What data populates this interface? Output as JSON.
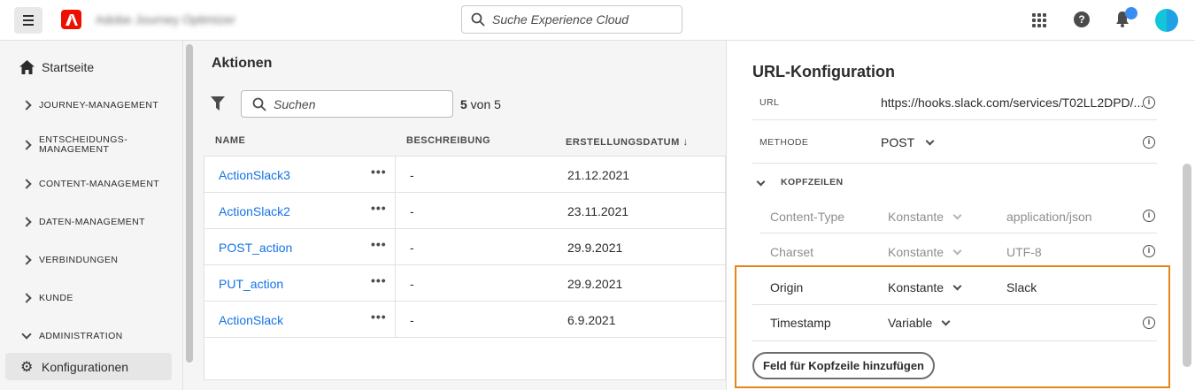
{
  "topbar": {
    "app_name": "Adobe Journey Optimizer",
    "search_placeholder": "Suche Experience Cloud"
  },
  "sidebar": {
    "home_label": "Startseite",
    "items": [
      {
        "label": "JOURNEY-MANAGEMENT"
      },
      {
        "label": "ENTSCHEIDUNGS-\nMANAGEMENT"
      },
      {
        "label": "CONTENT-MANAGEMENT"
      },
      {
        "label": "DATEN-MANAGEMENT"
      },
      {
        "label": "VERBINDUNGEN"
      },
      {
        "label": "KUNDE"
      },
      {
        "label": "ADMINISTRATION"
      }
    ],
    "active_label": "Konfigurationen"
  },
  "main": {
    "title": "Aktionen",
    "search_placeholder": "Suchen",
    "count_bold": "5",
    "count_rest": " von 5",
    "columns": [
      "NAME",
      "BESCHREIBUNG",
      "ERSTELLUNGSDATUM"
    ],
    "rows": [
      {
        "name": "ActionSlack3",
        "desc": "-",
        "date": "21.12.2021"
      },
      {
        "name": "ActionSlack2",
        "desc": "-",
        "date": "23.11.2021"
      },
      {
        "name": "POST_action",
        "desc": "-",
        "date": "29.9.2021"
      },
      {
        "name": "PUT_action",
        "desc": "-",
        "date": "29.9.2021"
      },
      {
        "name": "ActionSlack",
        "desc": "-",
        "date": "6.9.2021"
      }
    ],
    "more_glyph": "•••"
  },
  "panel": {
    "title": "URL-Konfiguration",
    "url_label": "URL",
    "url_value": "https://hooks.slack.com/services/T02LL2DPD/...",
    "method_label": "METHODE",
    "method_value": "POST",
    "headers_label": "KOPFZEILEN",
    "headers": [
      {
        "name": "Content-Type",
        "type": "Konstante",
        "value": "application/json"
      },
      {
        "name": "Charset",
        "type": "Konstante",
        "value": "UTF-8"
      },
      {
        "name": "Origin",
        "type": "Konstante",
        "value": "Slack"
      },
      {
        "name": "Timestamp",
        "type": "Variable",
        "value": ""
      }
    ],
    "add_header_button": "Feld für Kopfzeile hinzufügen"
  },
  "colors": {
    "accent_link": "#1473e6",
    "highlight_border": "#e68619",
    "adobe_red": "#eb1000"
  }
}
